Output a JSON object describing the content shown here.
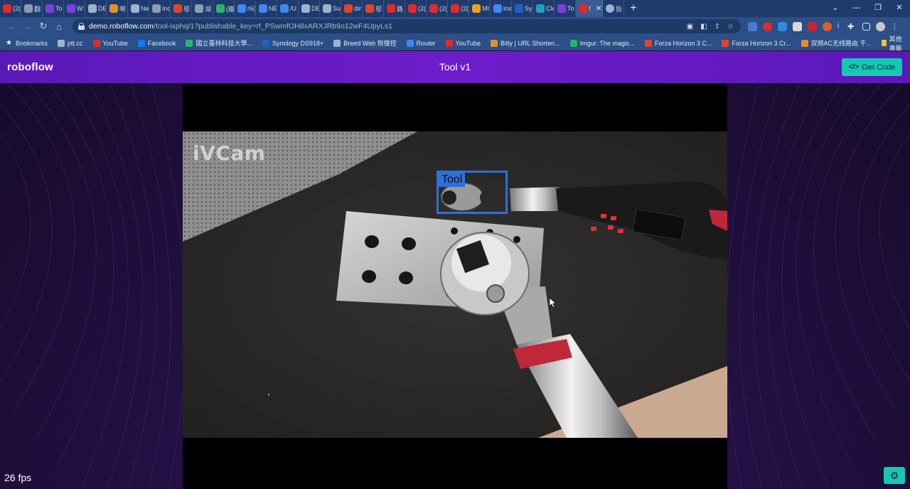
{
  "browser": {
    "tabs": [
      {
        "title": "(2(",
        "color": "#e02b2b"
      },
      {
        "title": "翻",
        "color": "#8f9bb3"
      },
      {
        "title": "To",
        "color": "#7b3fe4"
      },
      {
        "title": "W:",
        "color": "#7b3fe4"
      },
      {
        "title": "DE",
        "color": "#9fb2d0"
      },
      {
        "title": "啊",
        "color": "#e0902b"
      },
      {
        "title": "Ne",
        "color": "#9fb2d0"
      },
      {
        "title": "Inc",
        "color": "#8f9bb3"
      },
      {
        "title": "邬",
        "color": "#e0452b"
      },
      {
        "title": "湖",
        "color": "#8f9bb3"
      },
      {
        "title": "(瓣",
        "color": "#2bb36b"
      },
      {
        "title": "r6(",
        "color": "#4285f4"
      },
      {
        "title": "NE",
        "color": "#4285f4"
      },
      {
        "title": "/U",
        "color": "#4285f4"
      },
      {
        "title": "DE",
        "color": "#9fb2d0"
      },
      {
        "title": "Su",
        "color": "#9fb2d0"
      },
      {
        "title": "dir",
        "color": "#e0452b"
      },
      {
        "title": "邬",
        "color": "#e0452b"
      },
      {
        "title": "路",
        "color": "#e02b2b"
      },
      {
        "title": "(2(",
        "color": "#e02b2b"
      },
      {
        "title": "(2(",
        "color": "#e02b2b"
      },
      {
        "title": "(2(",
        "color": "#e02b2b"
      },
      {
        "title": "MI",
        "color": "#f0a020"
      },
      {
        "title": "ins",
        "color": "#4285f4"
      },
      {
        "title": "Sy",
        "color": "#2060c0"
      },
      {
        "title": "Cle",
        "color": "#20a0c0"
      },
      {
        "title": "To",
        "color": "#7b3fe4"
      }
    ],
    "active_tab": {
      "title": "f",
      "close": "✕"
    },
    "extra_tab": {
      "title": "投"
    },
    "new_tab": "+",
    "window_controls": [
      "⌄",
      "—",
      "❐",
      "✕"
    ],
    "url_host": "demo.roboflow.com",
    "url_path": "/tool-ixphq/1?publishable_key=rf_PSwmfOH8xARXJRb9o12wF4UpyLs1",
    "bookmarks": [
      {
        "label": "Bookmarks",
        "color": "#ffffff"
      },
      {
        "label": "ptt.cc",
        "color": "#9fb2d0"
      },
      {
        "label": "YouTube",
        "color": "#e02b2b"
      },
      {
        "label": "Facebook",
        "color": "#1877f2"
      },
      {
        "label": "國立臺林科技大學...",
        "color": "#2bb36b"
      },
      {
        "label": "Synology DS918+",
        "color": "#2060c0"
      },
      {
        "label": "Breed Web 恢復控",
        "color": "#9fb2d0"
      },
      {
        "label": "Router",
        "color": "#4285f4"
      },
      {
        "label": "YouTube",
        "color": "#e02b2b"
      },
      {
        "label": "Bitly | URL Shorten...",
        "color": "#e0902b"
      },
      {
        "label": "Imgur: The magic...",
        "color": "#2bb36b"
      },
      {
        "label": "Forza Horizon 3 C...",
        "color": "#e0452b"
      },
      {
        "label": "Forza Horizon 3 Cr...",
        "color": "#e0452b"
      },
      {
        "label": "双频AC无线路由 千...",
        "color": "#e0902b"
      }
    ],
    "other_bookmarks": "其他書籤"
  },
  "app": {
    "logo": "roboflow",
    "title": "Tool v1",
    "get_code_label": "Get Code",
    "get_code_icon": "</>",
    "fps": "26 fps",
    "settings_icon": "⚙"
  },
  "video": {
    "watermark": "iVCam",
    "detection_label": "Tool",
    "box_color": "#2f6fd8"
  }
}
